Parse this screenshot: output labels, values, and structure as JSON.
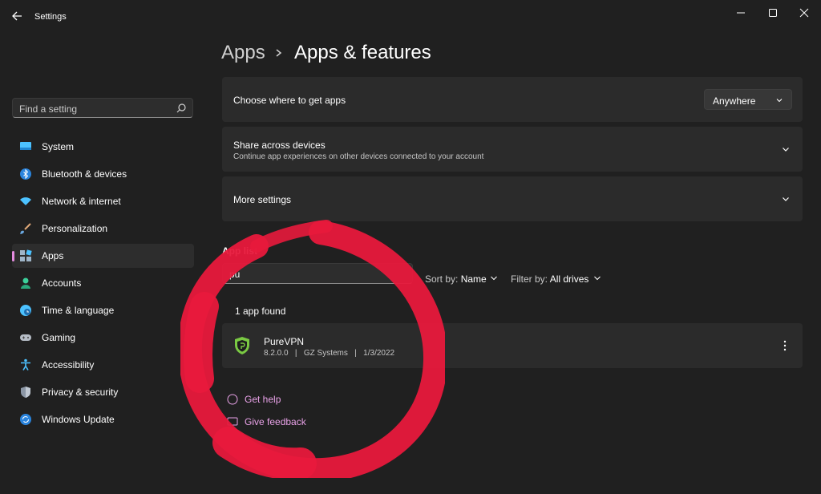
{
  "window": {
    "title": "Settings"
  },
  "sidebar": {
    "search_placeholder": "Find a setting",
    "items": [
      {
        "label": "System",
        "icon": "monitor-icon"
      },
      {
        "label": "Bluetooth & devices",
        "icon": "bluetooth-icon"
      },
      {
        "label": "Network & internet",
        "icon": "wifi-icon"
      },
      {
        "label": "Personalization",
        "icon": "brush-icon"
      },
      {
        "label": "Apps",
        "icon": "apps-icon",
        "active": true
      },
      {
        "label": "Accounts",
        "icon": "person-icon"
      },
      {
        "label": "Time & language",
        "icon": "globe-clock-icon"
      },
      {
        "label": "Gaming",
        "icon": "gamepad-icon"
      },
      {
        "label": "Accessibility",
        "icon": "accessibility-icon"
      },
      {
        "label": "Privacy & security",
        "icon": "shield-icon"
      },
      {
        "label": "Windows Update",
        "icon": "update-icon"
      }
    ]
  },
  "breadcrumb": {
    "parent": "Apps",
    "current": "Apps & features"
  },
  "cards": {
    "get_apps": {
      "title": "Choose where to get apps",
      "value": "Anywhere"
    },
    "share": {
      "title": "Share across devices",
      "subtitle": "Continue app experiences on other devices connected to your account"
    },
    "more": {
      "title": "More settings"
    }
  },
  "app_list": {
    "label": "App list",
    "search_value": "pu",
    "sort_prefix": "Sort by:",
    "sort_value": "Name",
    "filter_prefix": "Filter by:",
    "filter_value": "All drives",
    "found_text": "1 app found",
    "apps": [
      {
        "name": "PureVPN",
        "version": "8.2.0.0",
        "publisher": "GZ Systems",
        "date": "1/3/2022"
      }
    ]
  },
  "links": {
    "help": "Get help",
    "feedback": "Give feedback"
  },
  "colors": {
    "accent": "#e58ce0",
    "background": "#202020",
    "card": "#2b2b2b",
    "overlay": "#e8193c",
    "link": "#e9a2e8"
  }
}
